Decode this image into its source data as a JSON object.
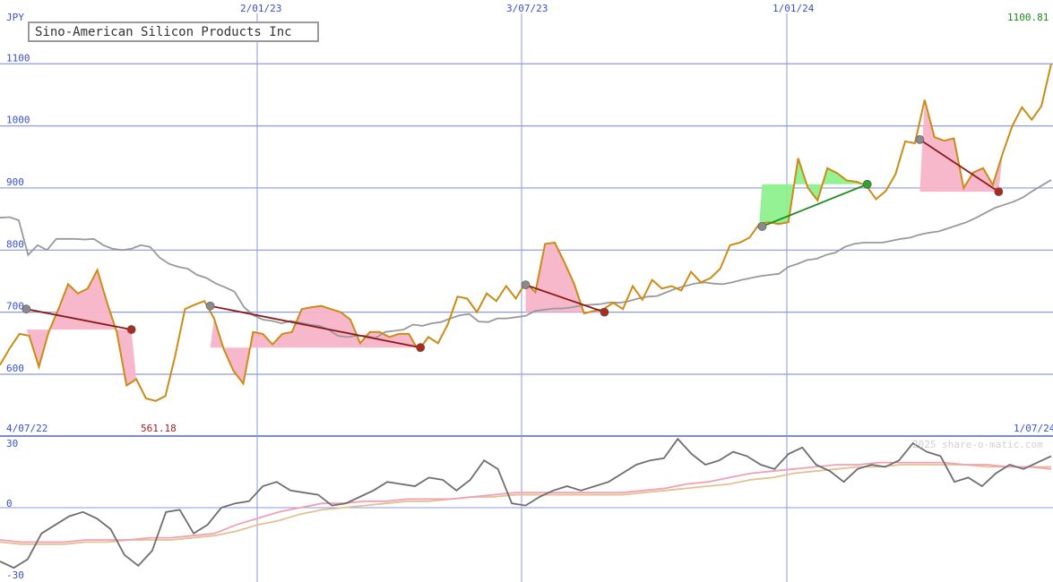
{
  "chart_data": [
    {
      "type": "line",
      "title": "Sino-American Silicon Products Inc",
      "currency": "JPY",
      "last_value_label": "1100.81",
      "low_value_label": "561.18",
      "date_labels": [
        "2/01/23",
        "3/07/23",
        "1/01/24"
      ],
      "start_date_label": "4/07/22",
      "end_date_label": "1/07/24",
      "ylim": [
        530,
        1150
      ],
      "yticks": [
        600,
        700,
        800,
        900,
        1000,
        1100
      ],
      "grid": true,
      "series": [
        {
          "color": "#cc8c14",
          "values": [
            615,
            642,
            665,
            662,
            612,
            668,
            705,
            745,
            730,
            738,
            768,
            715,
            668,
            582,
            592,
            561,
            557,
            565,
            630,
            705,
            712,
            718,
            690,
            640,
            605,
            585,
            668,
            665,
            648,
            665,
            668,
            705,
            708,
            710,
            705,
            700,
            688,
            650,
            668,
            668,
            660,
            665,
            665,
            638,
            660,
            650,
            680,
            725,
            722,
            700,
            730,
            718,
            742,
            722,
            748,
            732,
            810,
            812,
            780,
            745,
            698,
            702,
            705,
            715,
            705,
            742,
            720,
            752,
            738,
            742,
            735,
            765,
            748,
            755,
            770,
            808,
            812,
            820,
            842,
            845,
            842,
            845,
            948,
            900,
            880,
            932,
            924,
            912,
            910,
            904,
            882,
            895,
            922,
            975,
            972,
            1042,
            982,
            976,
            980,
            900,
            925,
            932,
            905,
            955,
            1000,
            1030,
            1010,
            1032,
            1100
          ]
        },
        {
          "color": "#999999",
          "values": [
            852,
            853,
            848,
            792,
            808,
            800,
            818,
            818,
            818,
            817,
            818,
            808,
            802,
            800,
            802,
            808,
            805,
            788,
            778,
            773,
            770,
            760,
            755,
            746,
            740,
            733,
            708,
            695,
            688,
            686,
            682,
            686,
            683,
            680,
            678,
            672,
            662,
            660,
            662,
            662,
            658,
            668,
            670,
            672,
            680,
            678,
            682,
            684,
            690,
            695,
            697,
            685,
            684,
            690,
            690,
            692,
            694,
            702,
            704,
            706,
            706,
            708,
            711,
            712,
            713,
            716,
            715,
            718,
            722,
            725,
            726,
            732,
            738,
            742,
            746,
            748,
            746,
            745,
            748,
            752,
            755,
            758,
            760,
            762,
            773,
            778,
            784,
            786,
            792,
            796,
            805,
            810,
            812,
            812,
            812,
            815,
            818,
            820,
            825,
            828,
            830,
            835,
            840,
            845,
            852,
            860,
            868,
            873,
            878,
            885,
            895,
            904,
            913
          ]
        }
      ],
      "signals": [
        {
          "from": [
            1,
            705
          ],
          "to": [
            5,
            672
          ]
        },
        {
          "from": [
            8,
            710
          ],
          "to": [
            16,
            643
          ]
        },
        {
          "from": [
            20,
            744
          ],
          "to": [
            23,
            700
          ]
        },
        {
          "from": [
            29,
            838
          ],
          "to": [
            33,
            906
          ]
        },
        {
          "from": [
            35,
            978
          ],
          "to": [
            38,
            894
          ]
        }
      ]
    },
    {
      "type": "line",
      "ylim": [
        -30,
        30
      ],
      "yticks": [
        30,
        0,
        -30
      ],
      "watermark": "2025 share-o-matic.com",
      "series": [
        {
          "color": "#6e6e6e",
          "values": [
            -25,
            -28,
            -24,
            -12,
            -8,
            -4,
            -2,
            -5,
            -10,
            -22,
            -27,
            -20,
            -2,
            -1,
            -12,
            -8,
            0,
            2,
            3,
            10,
            12,
            8,
            7,
            6,
            1,
            2,
            5,
            8,
            12,
            11,
            10,
            14,
            13,
            8,
            13,
            22,
            18,
            2,
            1,
            5,
            8,
            10,
            8,
            10,
            12,
            16,
            20,
            22,
            23,
            32,
            25,
            20,
            22,
            26,
            24,
            20,
            18,
            25,
            28,
            20,
            17,
            12,
            18,
            20,
            19,
            22,
            30,
            26,
            24,
            12,
            14,
            10,
            16,
            20,
            18,
            21,
            24
          ]
        },
        {
          "color": "#f0a0b4",
          "values": [
            -15,
            -16,
            -16,
            -16,
            -15,
            -15,
            -15,
            -14,
            -14,
            -13,
            -12,
            -8,
            -5,
            -2,
            0,
            2,
            2,
            3,
            3,
            4,
            4,
            4,
            5,
            6,
            7,
            7,
            7,
            7,
            7,
            7,
            8,
            9,
            11,
            12,
            14,
            16,
            17,
            18,
            19,
            20,
            20,
            21,
            21,
            21,
            21,
            20,
            20,
            19,
            19,
            18
          ]
        },
        {
          "color": "#e4c090",
          "values": [
            -16,
            -17,
            -17,
            -17,
            -16,
            -16,
            -15,
            -15,
            -15,
            -14,
            -13,
            -11,
            -8,
            -6,
            -3,
            -1,
            0,
            1,
            2,
            3,
            3,
            4,
            5,
            5,
            6,
            6,
            6,
            6,
            6,
            6,
            7,
            8,
            9,
            10,
            11,
            13,
            14,
            16,
            17,
            18,
            19,
            19,
            20,
            20,
            20,
            20,
            19,
            19,
            19,
            19
          ]
        }
      ]
    }
  ]
}
